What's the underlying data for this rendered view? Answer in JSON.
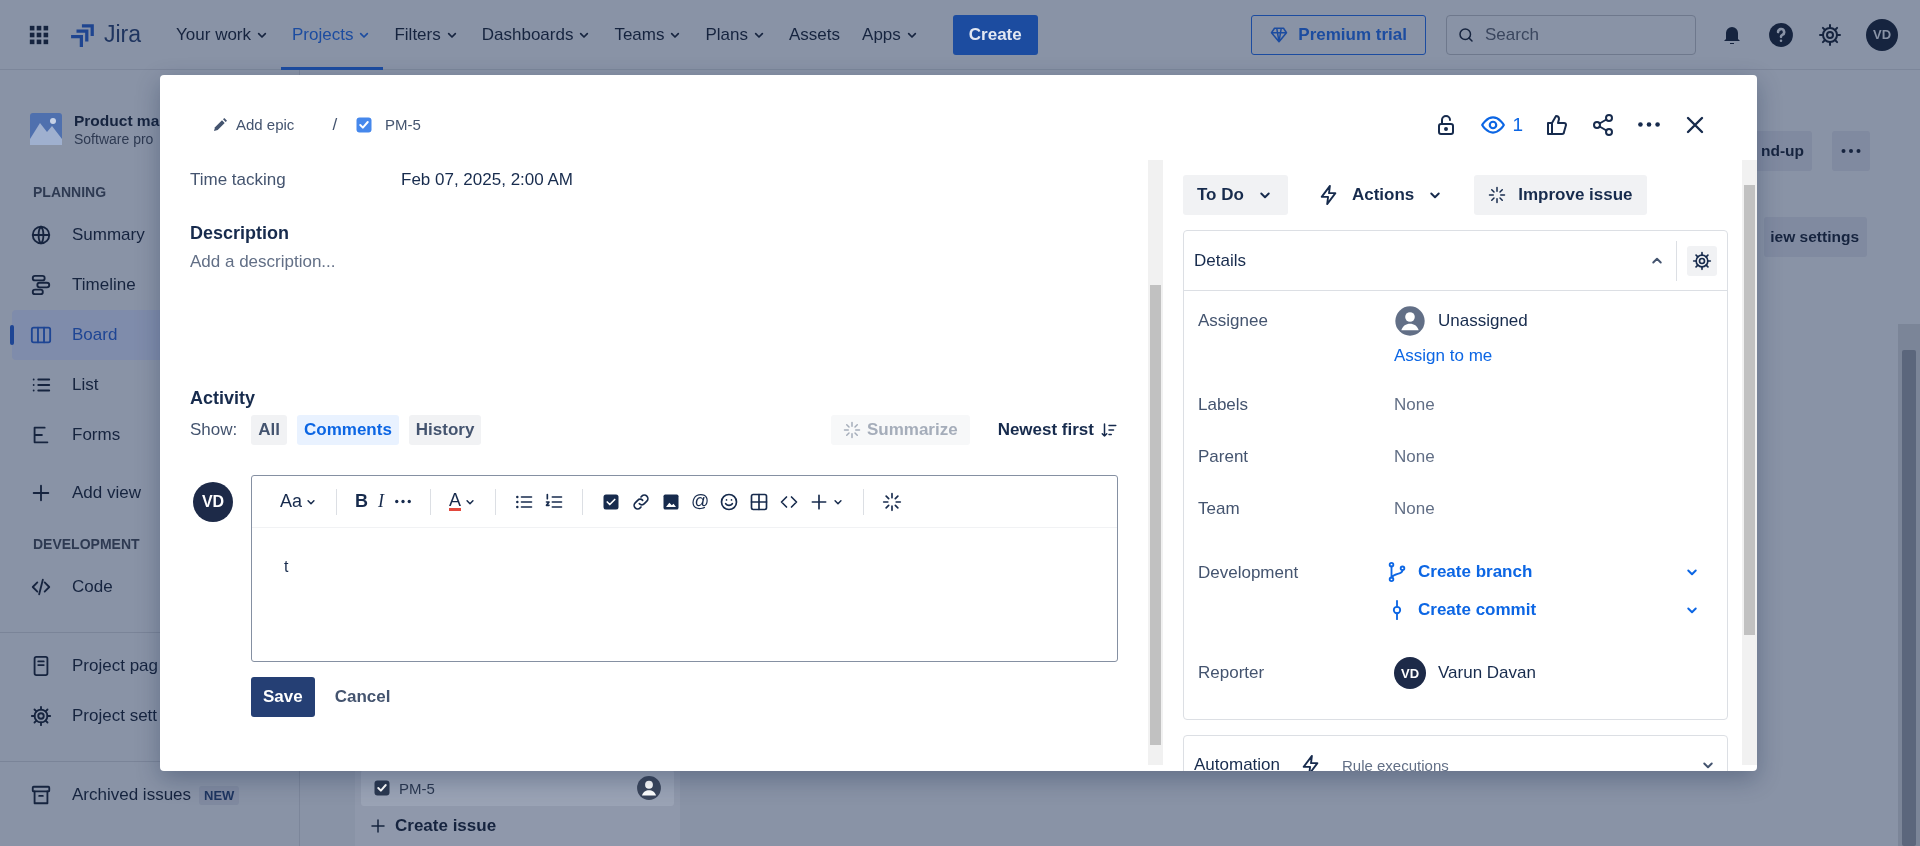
{
  "top_nav": {
    "product": "Jira",
    "items": [
      {
        "label": "Your work",
        "selected": false,
        "dropdown": true
      },
      {
        "label": "Projects",
        "selected": true,
        "dropdown": true
      },
      {
        "label": "Filters",
        "selected": false,
        "dropdown": true
      },
      {
        "label": "Dashboards",
        "selected": false,
        "dropdown": true
      },
      {
        "label": "Teams",
        "selected": false,
        "dropdown": true
      },
      {
        "label": "Plans",
        "selected": false,
        "dropdown": true
      },
      {
        "label": "Assets",
        "selected": false,
        "dropdown": false
      },
      {
        "label": "Apps",
        "selected": false,
        "dropdown": true
      }
    ],
    "create_button": "Create",
    "premium_button": "Premium trial",
    "search": {
      "placeholder": "Search"
    },
    "avatar": "VD"
  },
  "sidebar": {
    "project": {
      "name": "Product ma",
      "type": "Software pro"
    },
    "groups": [
      {
        "heading": "PLANNING",
        "items": [
          {
            "label": "Summary",
            "kind": "globe",
            "selected": false
          },
          {
            "label": "Timeline",
            "kind": "timeline",
            "selected": false
          },
          {
            "label": "Board",
            "kind": "board",
            "selected": true
          },
          {
            "label": "List",
            "kind": "list",
            "selected": false
          },
          {
            "label": "Forms",
            "kind": "forms",
            "selected": false
          },
          {
            "label": "Add view",
            "kind": "plus",
            "selected": false
          }
        ]
      },
      {
        "heading": "DEVELOPMENT",
        "items": [
          {
            "label": "Code",
            "kind": "code",
            "selected": false
          }
        ]
      },
      {
        "divider": true,
        "items": [
          {
            "label": "Project pag",
            "kind": "page",
            "selected": false
          },
          {
            "label": "Project sett",
            "kind": "gear",
            "selected": false
          }
        ]
      },
      {
        "divider": true,
        "items": [
          {
            "label": "Archived issues",
            "kind": "archive",
            "selected": false,
            "badge": "NEW"
          }
        ]
      }
    ]
  },
  "board": {
    "header_button": "nd-up",
    "view_settings_button": "iew settings",
    "card_key": "PM-5",
    "create_issue": "Create issue"
  },
  "issue": {
    "breadcrumb": {
      "parent": "Add epic",
      "separator": "/",
      "key": "PM-5"
    },
    "watchers": "1",
    "fields": [
      {
        "label": "Time tacking",
        "value": "Feb 07, 2025, 2:00 AM"
      }
    ],
    "description": {
      "heading": "Description",
      "placeholder": "Add a description..."
    },
    "activity": {
      "heading": "Activity",
      "show_label": "Show:",
      "filters": [
        {
          "label": "All",
          "selected": false
        },
        {
          "label": "Comments",
          "selected": true
        },
        {
          "label": "History",
          "selected": false
        }
      ],
      "summarize": {
        "label": "Summarize",
        "disabled": true
      },
      "sort": "Newest first"
    },
    "comment_editor": {
      "avatar": "VD",
      "toolbar": [
        [
          {
            "kind": "text",
            "label": "Aa",
            "dropdown": true
          }
        ],
        [
          {
            "kind": "bold",
            "label": "B"
          },
          {
            "kind": "italic",
            "label": "I"
          },
          {
            "kind": "more"
          }
        ],
        [
          {
            "kind": "color",
            "label": "A",
            "dropdown": true
          }
        ],
        [
          {
            "kind": "bullets"
          },
          {
            "kind": "numbers"
          }
        ],
        [
          {
            "kind": "task"
          },
          {
            "kind": "link"
          },
          {
            "kind": "image"
          },
          {
            "kind": "text",
            "label": "@"
          },
          {
            "kind": "emoji"
          },
          {
            "kind": "table"
          },
          {
            "kind": "codetag"
          },
          {
            "kind": "plus",
            "dropdown": true
          }
        ],
        [
          {
            "kind": "sparkle"
          }
        ]
      ],
      "text": "t",
      "save": "Save",
      "cancel": "Cancel"
    },
    "status_button": "To Do",
    "actions_button": "Actions",
    "improve_button": "Improve issue",
    "details": {
      "title": "Details",
      "expanded": true,
      "fields": [
        {
          "kind": "user",
          "label": "Assignee",
          "value": "Unassigned",
          "link": "Assign to me"
        },
        {
          "kind": "text",
          "label": "Labels",
          "value": "None"
        },
        {
          "kind": "text",
          "label": "Parent",
          "value": "None"
        },
        {
          "kind": "text",
          "label": "Team",
          "value": "None"
        },
        {
          "kind": "links",
          "label": "Development",
          "links": [
            {
              "label": "Create branch",
              "kind": "branch"
            },
            {
              "label": "Create commit",
              "kind": "commit"
            }
          ]
        },
        {
          "kind": "user",
          "label": "Reporter",
          "value": "Varun Davan",
          "initials": "VD"
        }
      ]
    },
    "automation": {
      "title": "Automation",
      "subtitle": "Rule executions"
    }
  }
}
